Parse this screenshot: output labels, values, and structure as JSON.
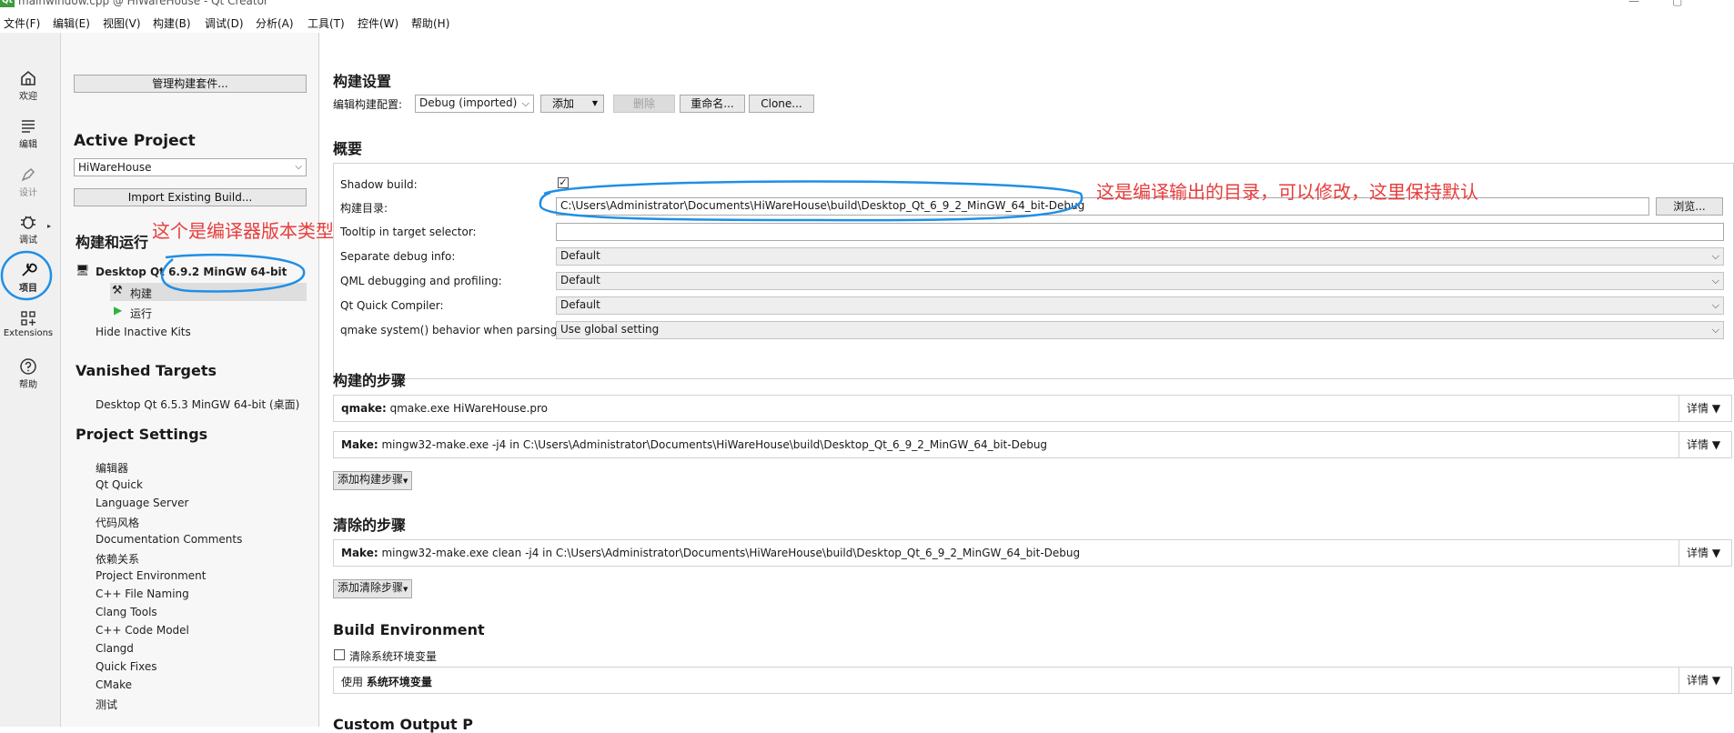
{
  "window": {
    "title": "mainwindow.cpp @ HiWareHouse - Qt Creator",
    "app_icon": "Qt"
  },
  "menubar": [
    "文件(F)",
    "编辑(E)",
    "视图(V)",
    "构建(B)",
    "调试(D)",
    "分析(A)",
    "工具(T)",
    "控件(W)",
    "帮助(H)"
  ],
  "modes": [
    {
      "label": "欢迎",
      "icon": "home-icon"
    },
    {
      "label": "编辑",
      "icon": "edit-lines-icon"
    },
    {
      "label": "设计",
      "icon": "design-pen-icon"
    },
    {
      "label": "调试",
      "icon": "bug-icon"
    },
    {
      "label": "项目",
      "icon": "wrench-icon"
    },
    {
      "label": "Extensions",
      "icon": "extensions-icon"
    },
    {
      "label": "帮助",
      "icon": "help-icon"
    }
  ],
  "nav": {
    "manage_kits": "管理构建套件...",
    "active_project_header": "Active Project",
    "active_project": "HiWareHouse",
    "import_build": "Import Existing Build...",
    "build_run_header": "构建和运行",
    "kit_name": "Desktop Qt 6.9.2 MinGW 64-bit",
    "kit_build": "构建",
    "kit_run": "运行",
    "hide_inactive": "Hide Inactive Kits",
    "vanished_header": "Vanished Targets",
    "vanished_item": "Desktop Qt 6.5.3 MinGW 64-bit (桌面)",
    "settings_header": "Project Settings",
    "settings_items": [
      "编辑器",
      "Qt Quick",
      "Language Server",
      "代码风格",
      "Documentation Comments",
      "依赖关系",
      "Project Environment",
      "C++ File Naming",
      "Clang Tools",
      "C++ Code Model",
      "Clangd",
      "Quick Fixes",
      "CMake",
      "测试"
    ]
  },
  "build_settings": {
    "header": "构建设置",
    "config_label": "编辑构建配置:",
    "config_value": "Debug (imported)",
    "add": "添加",
    "delete": "删除",
    "rename": "重命名...",
    "clone": "Clone..."
  },
  "overview": {
    "header": "概要",
    "shadow_build_label": "Shadow build:",
    "build_dir_label": "构建目录:",
    "build_dir": "C:\\Users\\Administrator\\Documents\\HiWareHouse\\build\\Desktop_Qt_6_9_2_MinGW_64_bit-Debug",
    "browse": "浏览...",
    "tooltip_label": "Tooltip in target selector:",
    "tooltip_value": "",
    "rows": [
      {
        "label": "Separate debug info:",
        "value": "Default"
      },
      {
        "label": "QML debugging and profiling:",
        "value": "Default"
      },
      {
        "label": "Qt Quick Compiler:",
        "value": "Default"
      },
      {
        "label": "qmake system() behavior when parsing:",
        "value": "Use global setting"
      }
    ]
  },
  "build_steps": {
    "header": "构建的步骤",
    "steps": [
      {
        "bold": "qmake:",
        "text": " qmake.exe HiWareHouse.pro",
        "details": "详情"
      },
      {
        "bold": "Make:",
        "text": " mingw32-make.exe -j4 in C:\\Users\\Administrator\\Documents\\HiWareHouse\\build\\Desktop_Qt_6_9_2_MinGW_64_bit-Debug",
        "details": "详情"
      }
    ],
    "add": "添加构建步骤"
  },
  "clean_steps": {
    "header": "清除的步骤",
    "steps": [
      {
        "bold": "Make:",
        "text": " mingw32-make.exe clean -j4 in C:\\Users\\Administrator\\Documents\\HiWareHouse\\build\\Desktop_Qt_6_9_2_MinGW_64_bit-Debug",
        "details": "详情"
      }
    ],
    "add": "添加清除步骤"
  },
  "build_env": {
    "header": "Build Environment",
    "clear_label": "清除系统环境变量",
    "use_prefix": "使用 ",
    "use_bold": "系统环境变量",
    "details": "详情",
    "cut_header": "Custom Output P"
  },
  "annotations": {
    "compiler": "这个是编译器版本类型",
    "output_dir": "这是编译输出的目录，可以修改，这里保持默认"
  },
  "colors": {
    "annotation": "#e83c3c",
    "scribble": "#1f8fe6"
  }
}
